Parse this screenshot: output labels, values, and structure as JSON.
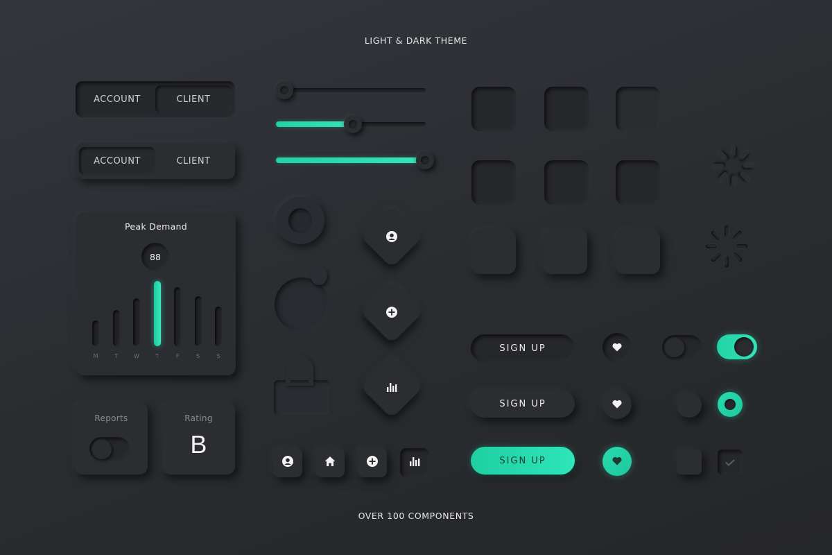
{
  "header": {
    "title": "LIGHT & DARK THEME"
  },
  "footer": {
    "caption": "OVER 100 COMPONENTS"
  },
  "segmented_controls": [
    {
      "options": [
        "ACCOUNT",
        "CLIENT"
      ],
      "selected": "CLIENT"
    },
    {
      "options": [
        "ACCOUNT",
        "CLIENT"
      ],
      "selected": "ACCOUNT"
    }
  ],
  "peak_demand_card": {
    "title": "Peak Demand",
    "highlight_value": "88",
    "accent_color": "#2ee0b4",
    "chart_data": {
      "type": "bar",
      "title": "Peak Demand",
      "categories": [
        "M",
        "T",
        "W",
        "T",
        "F",
        "S",
        "S"
      ],
      "values": [
        30,
        42,
        55,
        75,
        68,
        58,
        46
      ],
      "highlight_index": 3,
      "ylim": [
        0,
        80
      ]
    }
  },
  "reports_card": {
    "label": "Reports",
    "toggle_on": false
  },
  "rating_card": {
    "label": "Rating",
    "value": "B"
  },
  "sliders": [
    {
      "value_percent": 0
    },
    {
      "value_percent": 50
    },
    {
      "value_percent": 100
    }
  ],
  "decorative_icons": [
    "record-icon",
    "globe-icon",
    "unlock-icon"
  ],
  "diamond_buttons": [
    {
      "icon": "user-icon"
    },
    {
      "icon": "plus-icon"
    },
    {
      "icon": "bar-chart-icon"
    }
  ],
  "icon_buttons": [
    {
      "icon": "user-icon"
    },
    {
      "icon": "home-icon"
    },
    {
      "icon": "plus-icon"
    },
    {
      "icon": "bar-chart-icon"
    }
  ],
  "square_grid": {
    "rows": 3,
    "cols": 3
  },
  "loaders": [
    "spinner-raised",
    "spinner-inset"
  ],
  "signup_buttons": [
    {
      "label": "SIGN UP",
      "state": "pressed"
    },
    {
      "label": "SIGN UP",
      "state": "raised"
    },
    {
      "label": "SIGN UP",
      "state": "active"
    }
  ],
  "heart_buttons": [
    {
      "icon": "heart-icon",
      "active": false
    },
    {
      "icon": "heart-icon",
      "active": false
    },
    {
      "icon": "heart-icon",
      "active": true
    }
  ],
  "toggles": [
    {
      "on": false
    },
    {
      "on": true
    }
  ],
  "radios": [
    {
      "selected": false
    },
    {
      "selected": true
    }
  ],
  "checkboxes": [
    {
      "checked": false
    },
    {
      "checked": true
    }
  ],
  "colors": {
    "background": "#2b2d31",
    "accent": "#2ee0b4",
    "text": "#e6e6e6"
  }
}
